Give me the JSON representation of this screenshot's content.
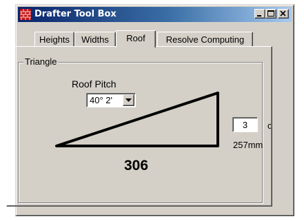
{
  "window": {
    "title": "Drafter Tool Box",
    "icon": "brick-wall-icon",
    "controls": [
      "minimize-icon",
      "maximize-icon",
      "close-icon"
    ]
  },
  "tabs": [
    {
      "label": "Heights",
      "active": false
    },
    {
      "label": "Widths",
      "active": false
    },
    {
      "label": "Roof",
      "active": true
    },
    {
      "label": "Resolve Computing",
      "active": false
    }
  ],
  "roof": {
    "group_label": "Triangle",
    "pitch_label": "Roof Pitch",
    "pitch_value": "40° 2'",
    "base_value": "306",
    "height_value": "3",
    "height_unit": "c",
    "height_mm": "257mm"
  },
  "colors": {
    "face": "#d4d0c8",
    "titlebar_start": "#0a246a",
    "titlebar_end": "#a6caf0",
    "icon_red": "#c0151a"
  }
}
